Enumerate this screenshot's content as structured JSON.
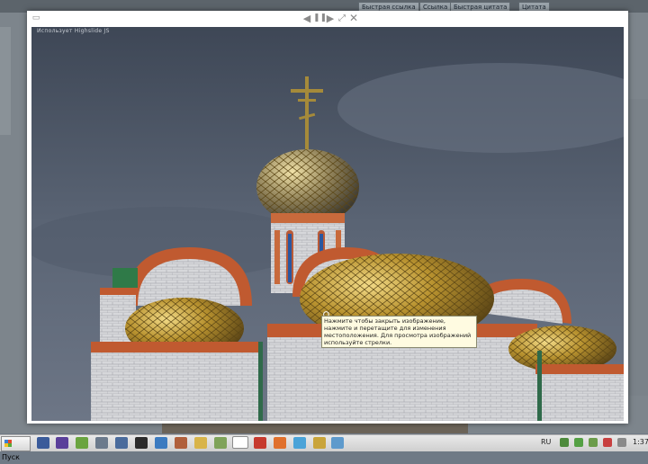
{
  "background_page": {
    "top_buttons": [
      "Быстрая ссылка",
      "Ссылка",
      "Быстрая цитата",
      "Цитата"
    ]
  },
  "viewer": {
    "credit": "Использует Highslide JS",
    "toolbar": [
      "back-arrow-icon",
      "pause-icon",
      "forward-arrow-icon",
      "resize-icon",
      "close-icon"
    ],
    "tooltip": "Нажмите чтобы закрыть изображение, нажмите и перетащите для изменения местоположения. Для просмотра изображений используйте стрелки."
  },
  "taskbar": {
    "start_label": "Пуск",
    "language": "RU",
    "clock": "1:37"
  },
  "colors": {
    "sky": "#4b5462",
    "gold_dome": "#b9922f",
    "brick": "#c0603a",
    "white_brick": "#d8d8dc"
  }
}
